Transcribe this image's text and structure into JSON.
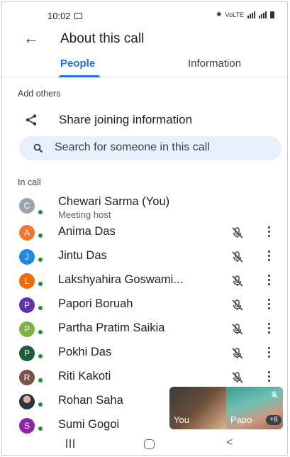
{
  "status_bar": {
    "time": "10:02",
    "network": "VoLTE"
  },
  "header": {
    "title": "About this call"
  },
  "tabs": [
    {
      "label": "People",
      "selected": true
    },
    {
      "label": "Information",
      "selected": false
    }
  ],
  "add_section": {
    "label": "Add others"
  },
  "share": {
    "label": "Share joining information"
  },
  "search": {
    "placeholder": "Search for someone in this call"
  },
  "in_call": {
    "label": "In call"
  },
  "participants": [
    {
      "initial": "C",
      "name": "Chewari Sarma (You)",
      "subtitle": "Meeting host",
      "color": "#9aa4ab",
      "muted": false
    },
    {
      "initial": "A",
      "name": "Anima Das",
      "color": "#f4752b",
      "muted": true
    },
    {
      "initial": "J",
      "name": "Jintu Das",
      "color": "#1e88e5",
      "muted": true
    },
    {
      "initial": "L",
      "name": "Lakshyahira Goswami...",
      "color": "#ef6c00",
      "muted": true
    },
    {
      "initial": "P",
      "name": "Papori Boruah",
      "color": "#5e35b1",
      "muted": true
    },
    {
      "initial": "P",
      "name": "Partha Pratim Saikia",
      "color": "#7cb342",
      "muted": true
    },
    {
      "initial": "P",
      "name": "Pokhi Das",
      "color": "#1b5e37",
      "muted": true
    },
    {
      "initial": "R",
      "name": "Riti Kakoti",
      "color": "#795548",
      "muted": true
    },
    {
      "initial": "",
      "name": "Rohan Saha",
      "color": "#455a64",
      "muted": false
    },
    {
      "initial": "S",
      "name": "Sumi Gogoi",
      "color": "#8e24aa",
      "muted": false
    }
  ],
  "pip": {
    "you_label": "You",
    "other_label": "Papo",
    "more_count": "+8"
  },
  "colors": {
    "accent": "#1a73e8",
    "search_bg": "#e8f0fe",
    "online": "#1e8e3e"
  }
}
